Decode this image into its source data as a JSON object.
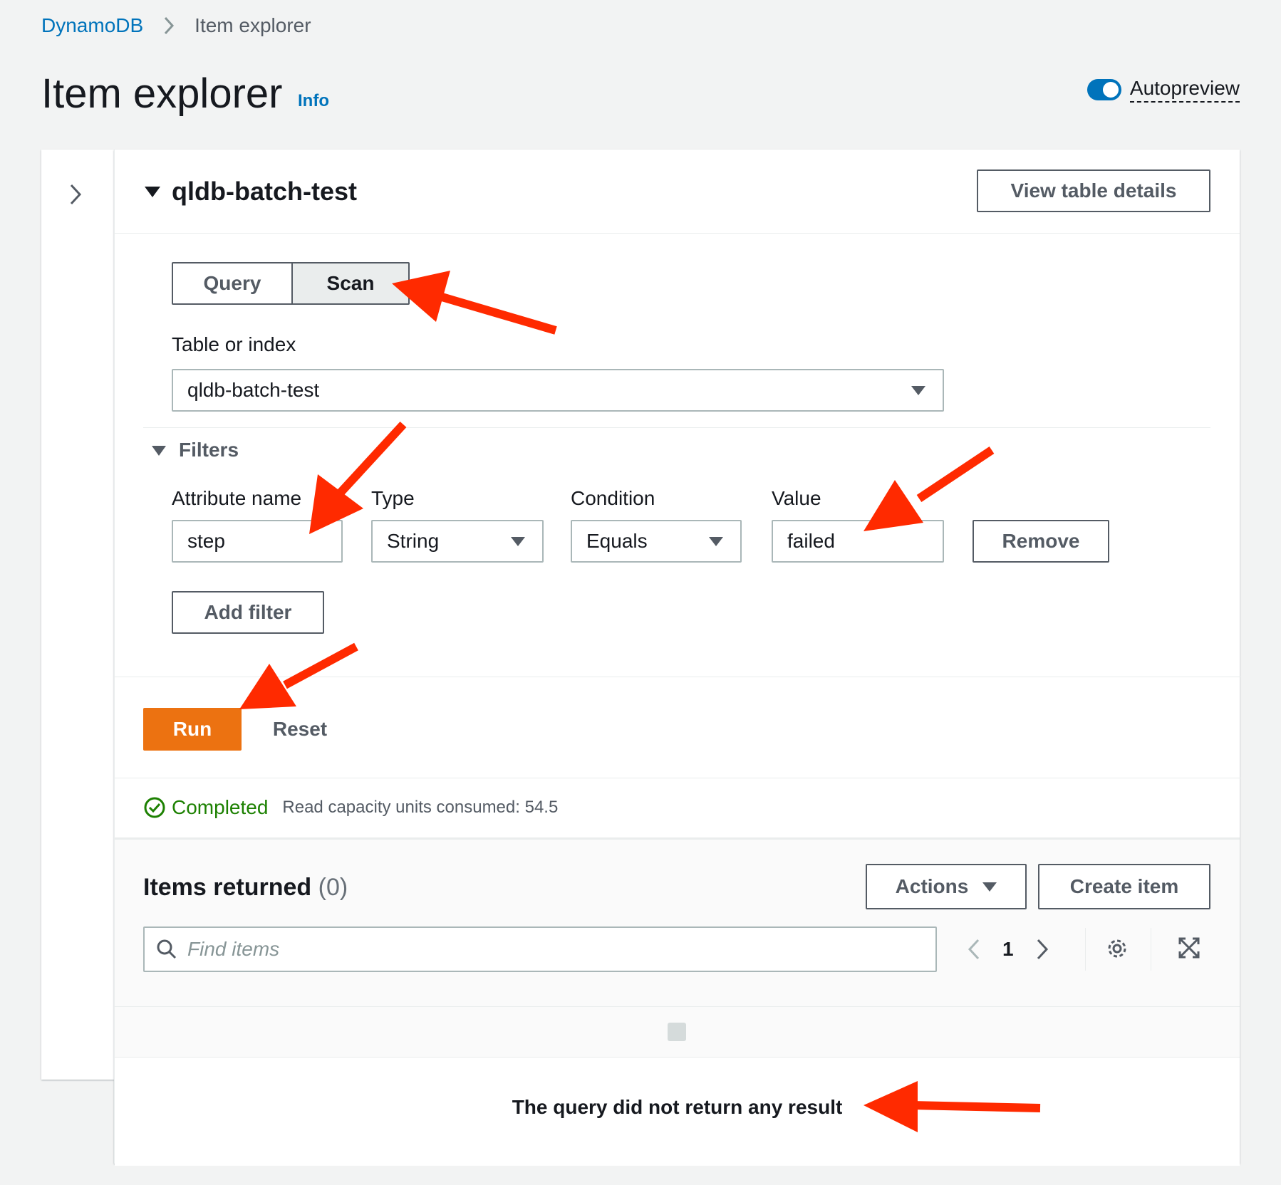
{
  "breadcrumb": {
    "root": "DynamoDB",
    "current": "Item explorer"
  },
  "header": {
    "title": "Item explorer",
    "info": "Info",
    "autopreview": "Autopreview",
    "autopreview_on": true
  },
  "panel": {
    "table_name": "qldb-batch-test",
    "view_details": "View table details",
    "mode_tabs": [
      "Query",
      "Scan"
    ],
    "active_mode": "Scan",
    "table_label": "Table or index",
    "table_value": "qldb-batch-test",
    "filters": {
      "label": "Filters",
      "attribute_label": "Attribute name",
      "attribute_value": "step",
      "type_label": "Type",
      "type_value": "String",
      "condition_label": "Condition",
      "condition_value": "Equals",
      "value_label": "Value",
      "value_value": "failed",
      "remove": "Remove",
      "add": "Add filter"
    },
    "run": "Run",
    "reset": "Reset",
    "status": "Completed",
    "status_detail": "Read capacity units consumed: 54.5"
  },
  "items": {
    "title": "Items returned",
    "count": "(0)",
    "actions": "Actions",
    "create": "Create item",
    "search_placeholder": "Find items",
    "page": "1",
    "empty": "The query did not return any result"
  },
  "colors": {
    "link": "#0073bb",
    "primary_button": "#ec7211",
    "success": "#1d8102",
    "annotation_arrow": "#ff2a00"
  },
  "icons": {
    "breadcrumb_separator": "chevron-right-icon",
    "side_toggle": "chevron-right-icon",
    "status": "check-circle-icon",
    "search": "search-icon",
    "prev_page": "chevron-left-icon",
    "next_page": "chevron-right-icon",
    "preferences": "gear-icon",
    "fullscreen": "expand-icon"
  }
}
